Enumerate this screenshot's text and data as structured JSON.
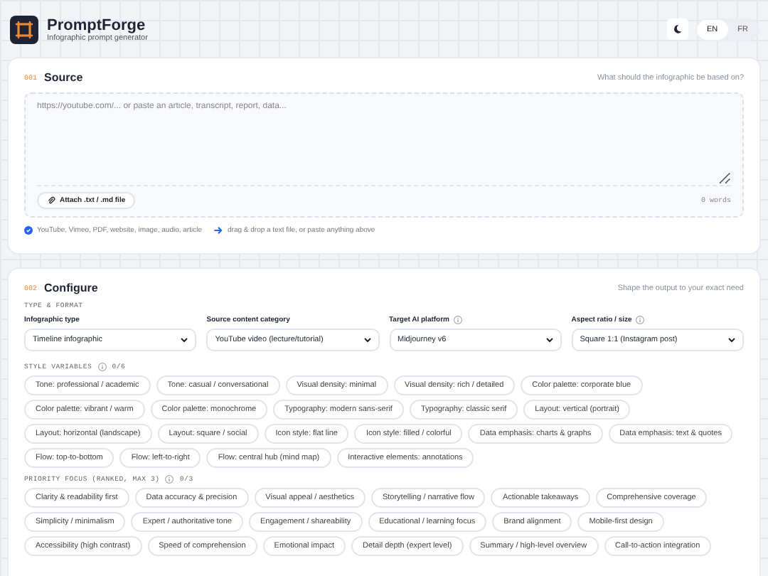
{
  "brand": {
    "name": "PromptForge",
    "tagline": "Infographic prompt generator"
  },
  "languages": [
    {
      "label": "EN",
      "selected": true
    },
    {
      "label": "FR",
      "selected": false
    }
  ],
  "source": {
    "number": "001",
    "title": "Source",
    "hint": "What should the infographic be based on?",
    "placeholder": "https://youtube.com/... or paste an article, transcript, report, data...",
    "attach": "Attach .txt / .md file",
    "word_count": "0 words",
    "supported": "YouTube, Vimeo, PDF, website, image, audio, article",
    "drop_hint": "drag & drop a text file, or paste anything above"
  },
  "configure": {
    "number": "002",
    "title": "Configure",
    "hint": "Shape the output to your exact need",
    "section": "TYPE & FORMAT",
    "fields": [
      {
        "label": "Infographic type",
        "value": "Timeline infographic"
      },
      {
        "label": "Source content category",
        "value": "YouTube video (lecture/tutorial)"
      },
      {
        "label": "Target AI platform",
        "value": "Midjourney v6",
        "info": true
      },
      {
        "label": "Aspect ratio / size",
        "value": "Square 1:1 (Instagram post)",
        "info": true
      }
    ],
    "groups": [
      {
        "title": "STYLE VARIABLES",
        "count": "0/6",
        "chips": [
          {
            "label": "Tone: professional / academic",
            "selected": false
          },
          {
            "label": "Tone: casual / conversational",
            "selected": false
          },
          {
            "label": "Visual density: minimal",
            "selected": false
          },
          {
            "label": "Visual density: rich / detailed",
            "selected": false
          },
          {
            "label": "Color palette: corporate blue",
            "selected": false
          },
          {
            "label": "Color palette: vibrant / warm",
            "selected": false
          },
          {
            "label": "Color palette: monochrome",
            "selected": false
          },
          {
            "label": "Typography: modern sans-serif",
            "selected": false
          },
          {
            "label": "Typography: classic serif",
            "selected": false
          },
          {
            "label": "Layout: vertical (portrait)",
            "selected": false
          },
          {
            "label": "Layout: horizontal (landscape)",
            "selected": false
          },
          {
            "label": "Layout: square / social",
            "selected": false
          },
          {
            "label": "Icon style: flat line",
            "selected": false
          },
          {
            "label": "Icon style: filled / colorful",
            "selected": false
          },
          {
            "label": "Data emphasis: charts & graphs",
            "selected": false
          },
          {
            "label": "Data emphasis: text & quotes",
            "selected": false
          },
          {
            "label": "Flow: top-to-bottom",
            "selected": false
          },
          {
            "label": "Flow: left-to-right",
            "selected": false
          },
          {
            "label": "Flow: central hub (mind map)",
            "selected": false
          },
          {
            "label": "Interactive elements: annotations",
            "selected": false
          }
        ]
      },
      {
        "title": "PRIORITY FOCUS (RANKED, MAX 3)",
        "count": "0/3",
        "chips": [
          {
            "label": "Clarity & readability first",
            "selected": false
          },
          {
            "label": "Data accuracy & precision",
            "selected": false
          },
          {
            "label": "Visual appeal / aesthetics",
            "selected": false
          },
          {
            "label": "Storytelling / narrative flow",
            "selected": false
          },
          {
            "label": "Actionable takeaways",
            "selected": false
          },
          {
            "label": "Comprehensive coverage",
            "selected": false
          },
          {
            "label": "Simplicity / minimalism",
            "selected": false
          },
          {
            "label": "Expert / authoritative tone",
            "selected": false
          },
          {
            "label": "Engagement / shareability",
            "selected": false
          },
          {
            "label": "Educational / learning focus",
            "selected": false
          },
          {
            "label": "Brand alignment",
            "selected": false
          },
          {
            "label": "Mobile-first design",
            "selected": false
          },
          {
            "label": "Accessibility (high contrast)",
            "selected": false
          },
          {
            "label": "Speed of comprehension",
            "selected": false
          },
          {
            "label": "Emotional impact",
            "selected": false
          },
          {
            "label": "Detail depth (expert level)",
            "selected": false
          },
          {
            "label": "Summary / high-level overview",
            "selected": false
          },
          {
            "label": "Call-to-action integration",
            "selected": false
          }
        ]
      }
    ]
  }
}
